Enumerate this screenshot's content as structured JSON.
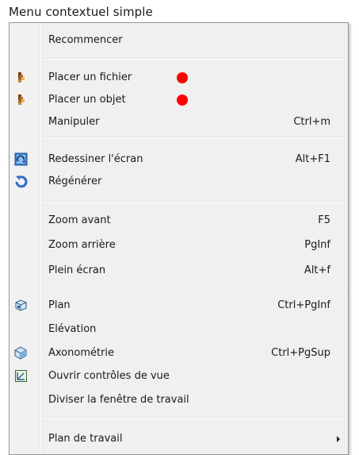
{
  "caption": "Menu contextuel simple",
  "accent": {
    "marker": "#ff0000"
  },
  "items": [
    {
      "label": "Recommencer",
      "shortcut": ""
    },
    {
      "label": "Placer un fichier",
      "shortcut": "",
      "icon": "place-file-icon",
      "marked": true
    },
    {
      "label": "Placer un objet",
      "shortcut": "",
      "icon": "place-object-icon",
      "marked": true
    },
    {
      "label": "Manipuler",
      "shortcut": "Ctrl+m"
    },
    {
      "label": "Redessiner l'écran",
      "shortcut": "Alt+F1",
      "icon": "redraw-icon"
    },
    {
      "label": "Régénérer",
      "shortcut": "",
      "icon": "regenerate-icon"
    },
    {
      "label": "Zoom avant",
      "shortcut": "F5"
    },
    {
      "label": "Zoom arrière",
      "shortcut": "PgInf"
    },
    {
      "label": "Plein écran",
      "shortcut": "Alt+f"
    },
    {
      "label": "Plan",
      "shortcut": "Ctrl+PgInf",
      "icon": "plan-view-icon"
    },
    {
      "label": "Elévation",
      "shortcut": ""
    },
    {
      "label": "Axonométrie",
      "shortcut": "Ctrl+PgSup",
      "icon": "axonometric-icon"
    },
    {
      "label": "Ouvrir contrôles de vue",
      "shortcut": "",
      "icon": "view-controls-icon"
    },
    {
      "label": "Diviser la fenêtre de travail",
      "shortcut": ""
    },
    {
      "label": "Plan de travail",
      "shortcut": "",
      "submenu": true
    }
  ]
}
